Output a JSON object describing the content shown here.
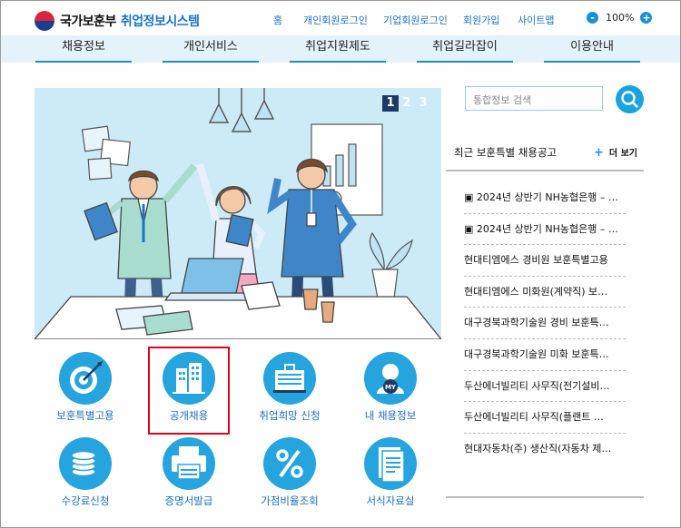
{
  "header": {
    "ministry": "국가보훈부",
    "system": "취업정보시스템",
    "links": [
      "홈",
      "개인회원로그인",
      "기업회원로그인",
      "회원가입",
      "사이트맵"
    ],
    "zoom_minus": "-",
    "zoom_value": "100%",
    "zoom_plus": "+"
  },
  "nav": {
    "items": [
      "채용정보",
      "개인서비스",
      "취업지원제도",
      "취업길라잡이",
      "이용안내"
    ]
  },
  "banner": {
    "pages": [
      "1",
      "2",
      "3"
    ],
    "active_page": "1"
  },
  "services": [
    {
      "label": "보훈특별고용",
      "icon": "target-icon"
    },
    {
      "label": "공개채용",
      "icon": "building-icon"
    },
    {
      "label": "취업희망 신청",
      "icon": "clipboard-icon"
    },
    {
      "label": "내 채용정보",
      "icon": "my-profile-icon"
    },
    {
      "label": "수강료신청",
      "icon": "coins-icon"
    },
    {
      "label": "증명서발급",
      "icon": "printer-icon"
    },
    {
      "label": "가점비율조회",
      "icon": "percent-icon"
    },
    {
      "label": "서식자료실",
      "icon": "document-icon"
    }
  ],
  "search": {
    "placeholder": "통합정보 검색"
  },
  "notices": {
    "title": "최근 보훈특별 채용공고",
    "more_plus": "+",
    "more_label": "더 보기",
    "items": [
      "▣ 2024년 상반기 NH농협은행 – …",
      "▣ 2024년 상반기 NH농협은행 – …",
      "현대티엠에스 경비원 보훈특별고용",
      "현대티엠에스 미화원(계약직) 보…",
      "대구경북과학기술원 경비 보훈특…",
      "대구경북과학기술원 미화 보훈특…",
      "두산에너빌리티 사무직(전기설비…",
      "두산에너빌리티 사무직(플랜트 …",
      "현대자동차(주) 생산직(자동차 제…"
    ]
  },
  "colors": {
    "accent": "#1b8fd4",
    "nav_bg": "#e4f3fb",
    "banner_bg": "#cdebf7",
    "highlight": "#e0001b"
  }
}
